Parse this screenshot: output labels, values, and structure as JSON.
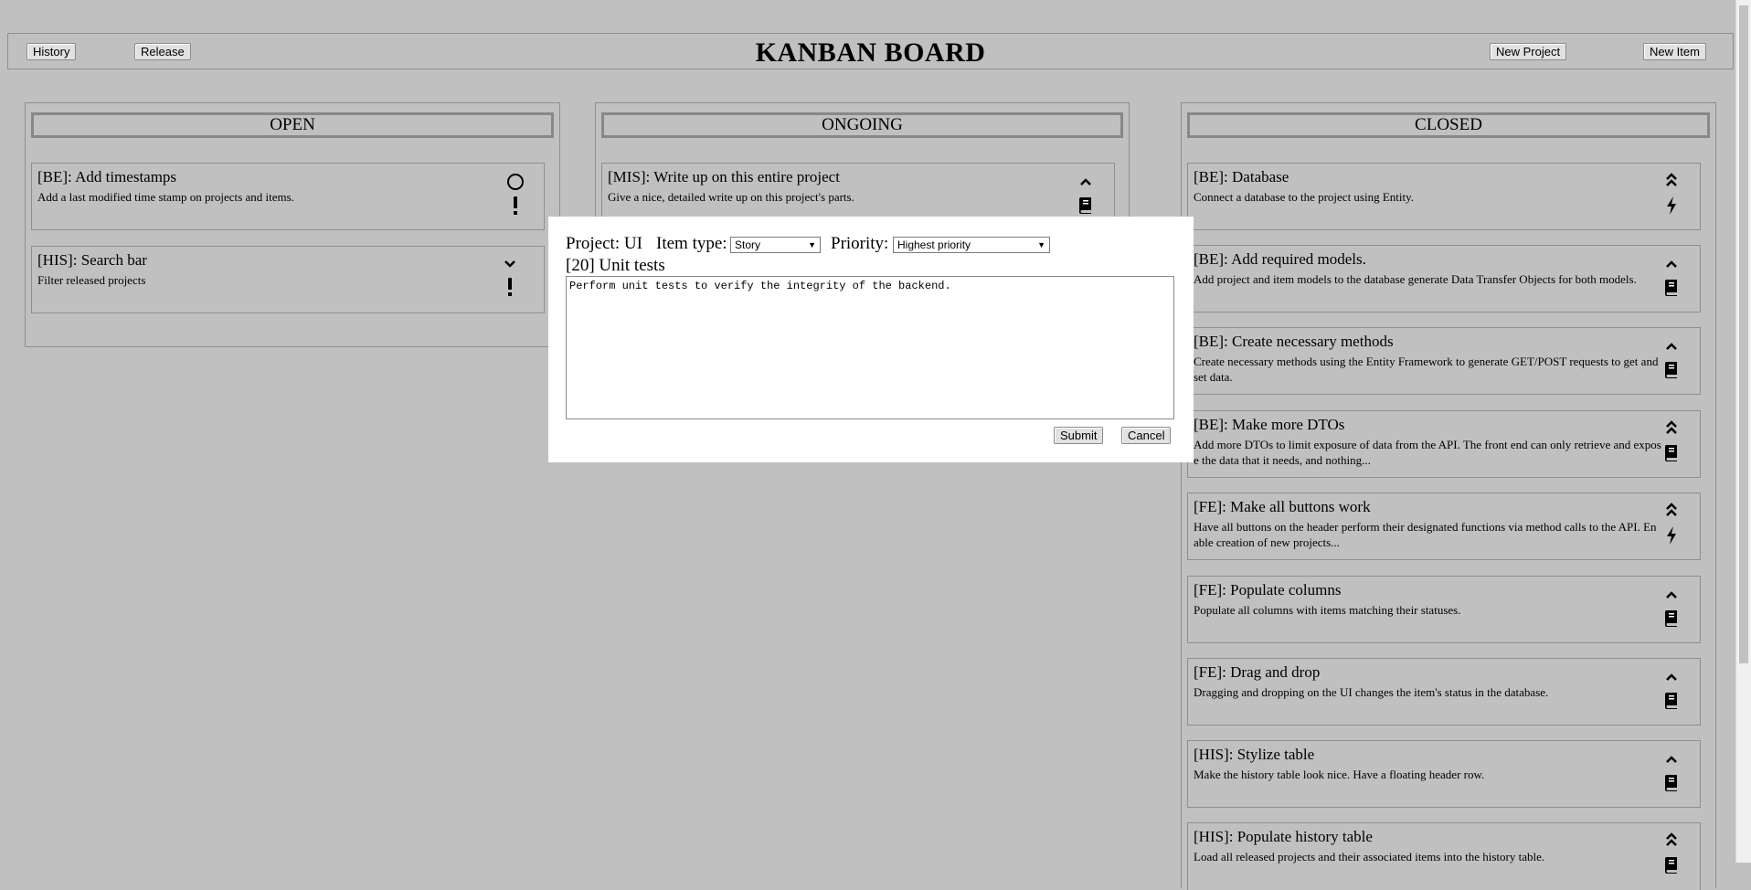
{
  "header": {
    "title": "KANBAN BOARD",
    "history_label": "History",
    "release_label": "Release",
    "new_project_label": "New Project",
    "new_item_label": "New Item"
  },
  "columns": {
    "open": {
      "title": "OPEN",
      "cards": [
        {
          "title": "[BE]: Add timestamps",
          "desc": "Add a last modified time stamp on projects and items.",
          "priority_icon": "circle-icon",
          "type_icon": "exclamation-icon"
        },
        {
          "title": "[HIS]: Search bar",
          "desc": "Filter released projects",
          "priority_icon": "chevron-down-icon",
          "type_icon": "exclamation-icon"
        }
      ]
    },
    "ongoing": {
      "title": "ONGOING",
      "cards": [
        {
          "title": "[MIS]: Write up on this entire project",
          "desc": "Give a nice, detailed write up on this project's parts.",
          "priority_icon": "chevron-up-icon",
          "type_icon": "book-icon"
        }
      ]
    },
    "closed": {
      "title": "CLOSED",
      "cards": [
        {
          "title": "[BE]: Database",
          "desc": "Connect a database to the project using Entity.",
          "priority_icon": "double-chevron-up-icon",
          "type_icon": "bolt-icon"
        },
        {
          "title": "[BE]: Add required models.",
          "desc": "Add project and item models to the database generate Data Transfer Objects for both models.",
          "priority_icon": "chevron-up-icon",
          "type_icon": "book-icon"
        },
        {
          "title": "[BE]: Create necessary methods",
          "desc": "Create necessary methods using the Entity Framework to generate GET/POST requests to get and set data.",
          "priority_icon": "chevron-up-icon",
          "type_icon": "book-icon"
        },
        {
          "title": "[BE]: Make more DTOs",
          "desc": "Add more DTOs to limit exposure of data from the API. The front end can only retrieve and expose the data that it needs, and nothing...",
          "priority_icon": "double-chevron-up-icon",
          "type_icon": "book-icon"
        },
        {
          "title": "[FE]: Make all buttons work",
          "desc": "Have all buttons on the header perform their designated functions via method calls to the API. Enable creation of new projects...",
          "priority_icon": "double-chevron-up-icon",
          "type_icon": "bolt-icon"
        },
        {
          "title": "[FE]: Populate columns",
          "desc": "Populate all columns with items matching their statuses.",
          "priority_icon": "chevron-up-icon",
          "type_icon": "book-icon"
        },
        {
          "title": "[FE]: Drag and drop",
          "desc": "Dragging and dropping on the UI changes the item's status in the database.",
          "priority_icon": "chevron-up-icon",
          "type_icon": "book-icon"
        },
        {
          "title": "[HIS]: Stylize table",
          "desc": "Make the history table look nice. Have a floating header row.",
          "priority_icon": "chevron-up-icon",
          "type_icon": "book-icon"
        },
        {
          "title": "[HIS]: Populate history table",
          "desc": "Load all released projects and their associated items into the history table.",
          "priority_icon": "double-chevron-up-icon",
          "type_icon": "book-icon"
        }
      ]
    }
  },
  "modal": {
    "project_label": "Project: UI",
    "item_type_label": "Item type:",
    "item_type_value": "Story",
    "priority_label": "Priority:",
    "priority_value": "Highest priority",
    "item_title": "[20] Unit tests",
    "description": "Perform unit tests to verify the integrity of the backend.",
    "submit_label": "Submit",
    "cancel_label": "Cancel"
  }
}
